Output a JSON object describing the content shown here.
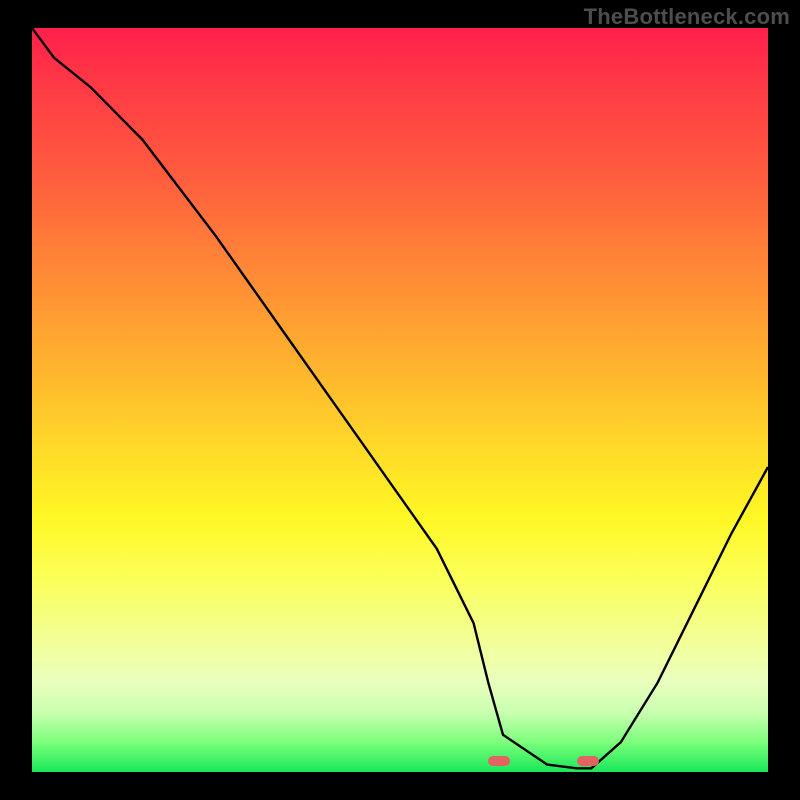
{
  "watermark": "TheBottleneck.com",
  "colors": {
    "background": "#000000",
    "curve": "#000000",
    "marker": "#e2635f",
    "gradient_top": "#ff1f4a",
    "gradient_bottom": "#18e858"
  },
  "chart_data": {
    "type": "line",
    "title": "",
    "xlabel": "",
    "ylabel": "",
    "xlim": [
      0,
      100
    ],
    "ylim": [
      0,
      100
    ],
    "series": [
      {
        "name": "bottleneck-curve",
        "x": [
          0,
          3,
          8,
          15,
          25,
          35,
          45,
          55,
          60,
          62,
          64,
          70,
          74,
          76,
          80,
          85,
          90,
          95,
          100
        ],
        "y": [
          100,
          96,
          92,
          85,
          72,
          58,
          44,
          30,
          20,
          12,
          5,
          1,
          0.5,
          0.5,
          4,
          12,
          22,
          32,
          41
        ]
      }
    ],
    "markers": [
      {
        "name": "optimal-range-left",
        "x_start": 62,
        "x_end": 65,
        "y": 1.5
      },
      {
        "name": "optimal-range-right",
        "x_start": 74,
        "x_end": 77,
        "y": 1.5
      }
    ]
  }
}
